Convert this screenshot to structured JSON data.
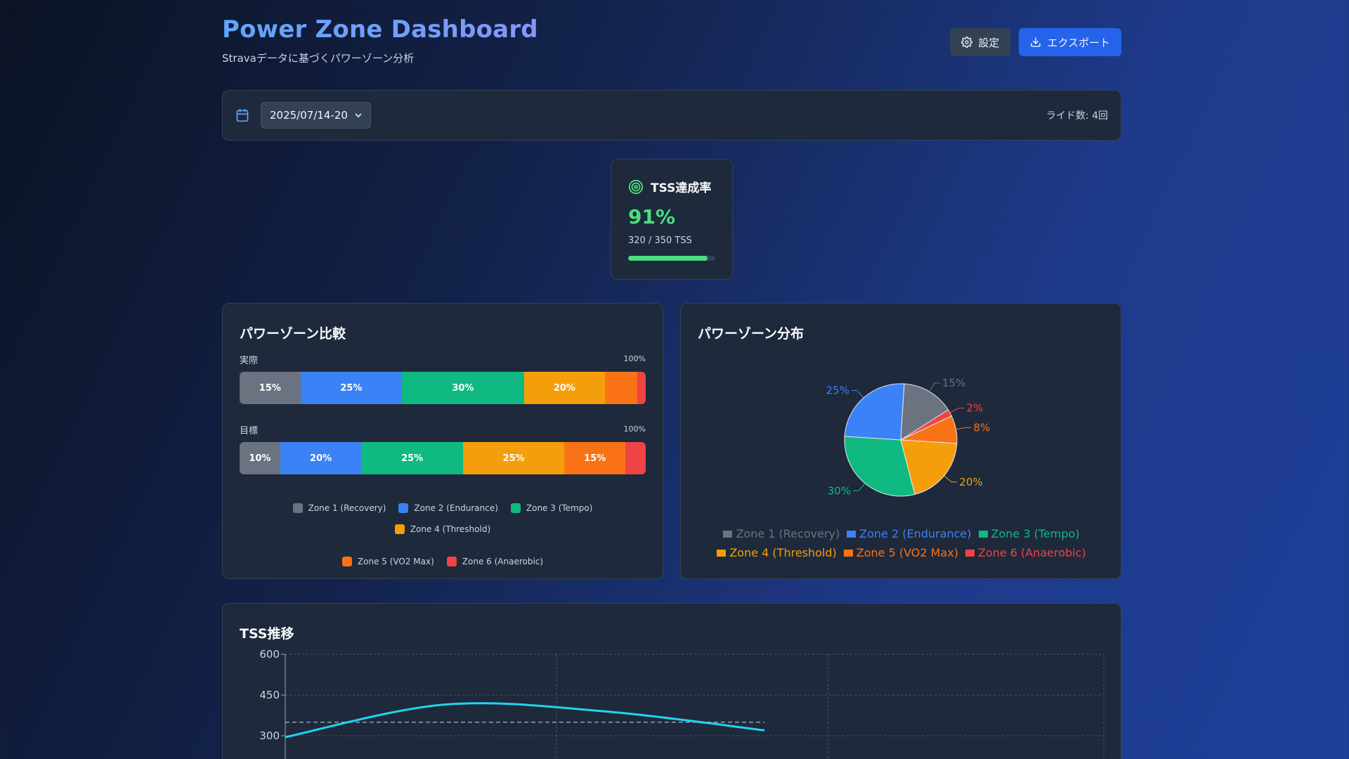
{
  "header": {
    "title": "Power Zone Dashboard",
    "subtitle": "Stravaデータに基づくパワーゾーン分析",
    "settings_label": "設定",
    "export_label": "エクスポート"
  },
  "filter": {
    "date_range": "2025/07/14-20",
    "ride_count": "ライド数: 4回"
  },
  "tss_card": {
    "title": "TSS達成率",
    "percent": "91%",
    "detail": "320 / 350 TSS",
    "progress": 0.91,
    "color": "#4ade80"
  },
  "zones": [
    {
      "name": "Zone 1 (Recovery)",
      "color": "#6b7280"
    },
    {
      "name": "Zone 2 (Endurance)",
      "color": "#3b82f6"
    },
    {
      "name": "Zone 3 (Tempo)",
      "color": "#10b981"
    },
    {
      "name": "Zone 4 (Threshold)",
      "color": "#f59e0b"
    },
    {
      "name": "Zone 5 (VO2 Max)",
      "color": "#f97316"
    },
    {
      "name": "Zone 6 (Anaerobic)",
      "color": "#ef4444"
    }
  ],
  "comparison": {
    "title": "パワーゾーン比較",
    "actual_label": "実際",
    "target_label": "目標",
    "max_label": "100%",
    "actual": [
      15,
      25,
      30,
      20,
      8,
      2
    ],
    "target": [
      10,
      20,
      25,
      25,
      15,
      5
    ]
  },
  "chart_data": [
    {
      "type": "pie",
      "title": "パワーゾーン分布",
      "categories": [
        "Zone 1 (Recovery)",
        "Zone 2 (Endurance)",
        "Zone 3 (Tempo)",
        "Zone 4 (Threshold)",
        "Zone 5 (VO2 Max)",
        "Zone 6 (Anaerobic)"
      ],
      "values": [
        15,
        25,
        30,
        20,
        8,
        2
      ],
      "labels": [
        "15%",
        "25%",
        "30%",
        "20%",
        "8%",
        "2%"
      ],
      "legend": "bottom"
    },
    {
      "type": "line",
      "title": "TSS推移",
      "yticks": [
        "600",
        "450",
        "300"
      ],
      "ylim": [
        150,
        600
      ],
      "x": [
        0,
        1,
        2,
        3
      ],
      "series": [
        {
          "values": [
            295,
            415,
            390,
            320
          ],
          "color": "#22d3ee"
        }
      ],
      "target_line": 350,
      "grid": true
    }
  ]
}
